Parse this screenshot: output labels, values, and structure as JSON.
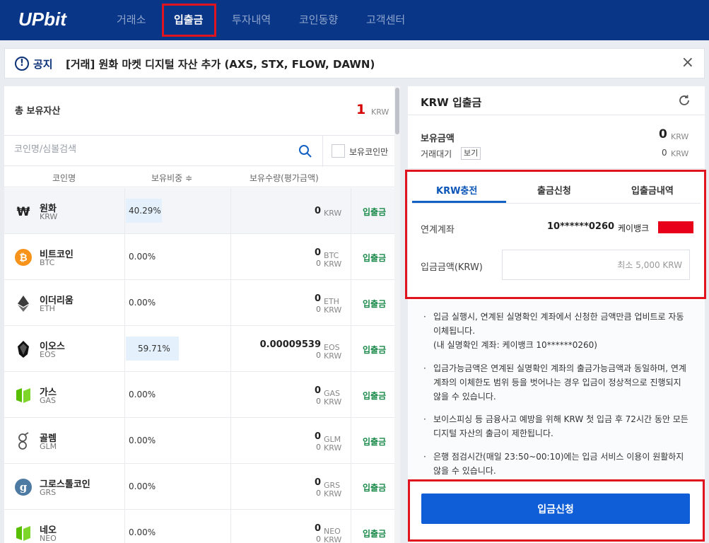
{
  "header": {
    "logo": "UPbit",
    "nav": [
      "거래소",
      "입출금",
      "투자내역",
      "코인동향",
      "고객센터"
    ],
    "active_nav": "입출금"
  },
  "notice": {
    "label": "공지",
    "text": "[거래] 원화 마켓 디지털 자산 추가 (AXS, STX, FLOW, DAWN)",
    "close": "×"
  },
  "assets": {
    "total_label": "총 보유자산",
    "total_value": "1",
    "total_unit": "KRW",
    "search_placeholder": "코인명/심볼검색",
    "owned_only_label": "보유코인만",
    "columns": [
      "코인명",
      "보유비중 ≑",
      "보유수량(평가금액)"
    ],
    "rows": [
      {
        "name": "원화",
        "symbol": "KRW",
        "ratio": "40.29%",
        "ratio_fraction": 0.4029,
        "qty": "0",
        "qty_unit": "KRW",
        "krw": "",
        "krw_unit": "",
        "action": "입출금",
        "icon": "won-icon"
      },
      {
        "name": "비트코인",
        "symbol": "BTC",
        "ratio": "0.00%",
        "ratio_fraction": 0,
        "qty": "0",
        "qty_unit": "BTC",
        "krw": "0",
        "krw_unit": "KRW",
        "action": "입출금",
        "icon": "bitcoin-icon"
      },
      {
        "name": "이더리움",
        "symbol": "ETH",
        "ratio": "0.00%",
        "ratio_fraction": 0,
        "qty": "0",
        "qty_unit": "ETH",
        "krw": "0",
        "krw_unit": "KRW",
        "action": "입출금",
        "icon": "ethereum-icon"
      },
      {
        "name": "이오스",
        "symbol": "EOS",
        "ratio": "59.71%",
        "ratio_fraction": 0.5971,
        "qty": "0.00009539",
        "qty_unit": "EOS",
        "krw": "0",
        "krw_unit": "KRW",
        "action": "입출금",
        "icon": "eos-icon"
      },
      {
        "name": "가스",
        "symbol": "GAS",
        "ratio": "0.00%",
        "ratio_fraction": 0,
        "qty": "0",
        "qty_unit": "GAS",
        "krw": "0",
        "krw_unit": "KRW",
        "action": "입출금",
        "icon": "gas-icon"
      },
      {
        "name": "골렘",
        "symbol": "GLM",
        "ratio": "0.00%",
        "ratio_fraction": 0,
        "qty": "0",
        "qty_unit": "GLM",
        "krw": "0",
        "krw_unit": "KRW",
        "action": "입출금",
        "icon": "golem-icon"
      },
      {
        "name": "그로스톨코인",
        "symbol": "GRS",
        "ratio": "0.00%",
        "ratio_fraction": 0,
        "qty": "0",
        "qty_unit": "GRS",
        "krw": "0",
        "krw_unit": "KRW",
        "action": "입출금",
        "icon": "groestlcoin-icon"
      },
      {
        "name": "네오",
        "symbol": "NEO",
        "ratio": "0.00%",
        "ratio_fraction": 0,
        "qty": "0",
        "qty_unit": "NEO",
        "krw": "0",
        "krw_unit": "KRW",
        "action": "입출금",
        "icon": "neo-icon"
      }
    ]
  },
  "deposit": {
    "title": "KRW 입출금",
    "balance_label": "보유금액",
    "balance_value": "0",
    "balance_unit": "KRW",
    "pending_label": "거래대기",
    "view_button": "보기",
    "pending_value": "0",
    "pending_unit": "KRW",
    "tabs": [
      "KRW충전",
      "출금신청",
      "입출금내역"
    ],
    "linked_account_label": "연계계좌",
    "account_number": "10******0260",
    "bank": "케이뱅크",
    "amount_label": "입금금액(KRW)",
    "amount_placeholder": "최소 5,000 KRW",
    "notes": [
      "입금 실행시, 연계된 실명확인 계좌에서 신청한 금액만큼 업비트로 자동 이체됩니다.\n(내 실명확인 계좌: 케이뱅크 10******0260)",
      "입금가능금액은 연계된 실명확인 계좌의 출금가능금액과 동일하며, 연계 계좌의 이체한도 범위 등을 벗어나는 경우 입금이 정상적으로 진행되지 않을 수 있습니다.",
      "보이스피싱 등 금융사고 예방을 위해 KRW 첫 입금 후 72시간 동안 모든 디지털 자산의 출금이 제한됩니다.",
      "은행 점검시간(매일 23:50~00:10)에는 입금 서비스 이용이 원활하지 않을 수 있습니다."
    ],
    "submit": "입금신청"
  },
  "colors": {
    "header_bg": "#093687",
    "highlight": "#e0141e",
    "primary": "#0f5ed7",
    "action_green": "#1a8a4a",
    "total_red": "#d60000"
  }
}
